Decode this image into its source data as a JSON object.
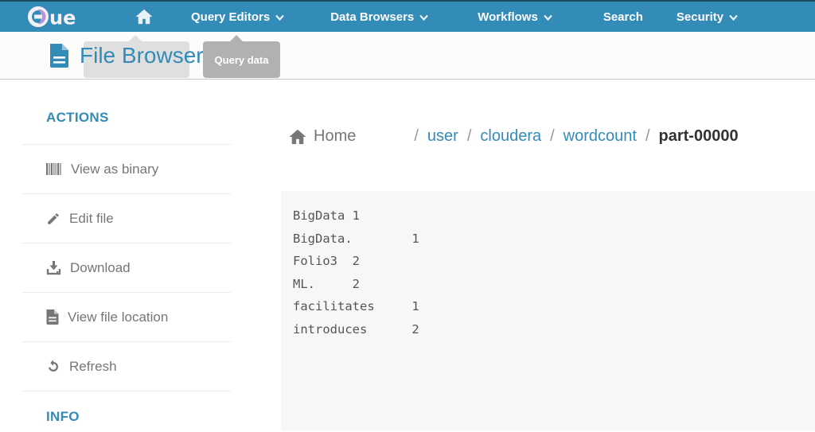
{
  "navbar": {
    "logo_text": "ue",
    "items": [
      {
        "label": "Query Editors",
        "has_dropdown": true
      },
      {
        "label": "Data Browsers",
        "has_dropdown": true
      },
      {
        "label": "Workflows",
        "has_dropdown": true
      },
      {
        "label": "Search",
        "has_dropdown": false
      },
      {
        "label": "Security",
        "has_dropdown": true
      }
    ]
  },
  "subheader": {
    "title": "File Browser",
    "tooltip_label": "Query data"
  },
  "sidebar": {
    "actions_heading": "ACTIONS",
    "info_heading": "INFO",
    "items": [
      {
        "label": "View as binary",
        "icon": "barcode-icon"
      },
      {
        "label": "Edit file",
        "icon": "pencil-icon"
      },
      {
        "label": "Download",
        "icon": "download-icon"
      },
      {
        "label": "View file location",
        "icon": "file-icon"
      },
      {
        "label": "Refresh",
        "icon": "refresh-icon"
      }
    ]
  },
  "breadcrumb": {
    "home_label": "Home",
    "separator": "/",
    "segments": [
      {
        "label": "user",
        "link": true
      },
      {
        "label": "cloudera",
        "link": true
      },
      {
        "label": "wordcount",
        "link": true
      },
      {
        "label": "part-00000",
        "link": false
      }
    ]
  },
  "file_content": {
    "text": "BigData\t1\nBigData.\t1\nFolio3\t2\nML.\t2\nfacilitates\t1\nintroduces\t2"
  },
  "colors": {
    "navbar_bg": "#338bb8",
    "accent_blue": "#338bb8",
    "tooltip_bg": "#b1b1b1",
    "content_bg": "#f7f7f7",
    "sidebar_text": "#767676",
    "mono_text": "#555555"
  }
}
